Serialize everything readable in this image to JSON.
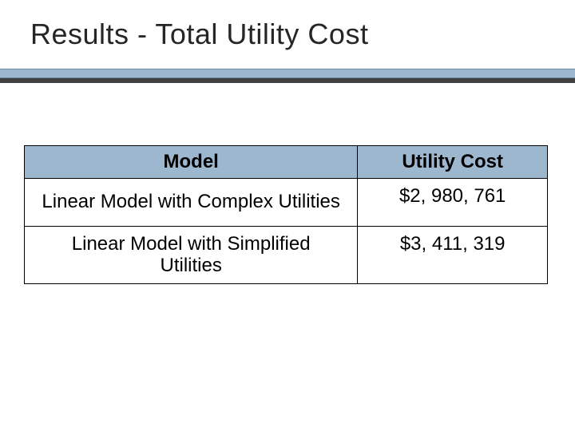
{
  "title": "Results  - Total Utility Cost",
  "table": {
    "headers": {
      "model": "Model",
      "cost": "Utility Cost"
    },
    "rows": [
      {
        "model": "Linear Model with Complex Utilities",
        "cost": "$2, 980, 761"
      },
      {
        "model": "Linear Model with Simplified Utilities",
        "cost": "$3, 411, 319"
      }
    ]
  },
  "colors": {
    "accent": "#9db7cf",
    "divider_dark": "#404040"
  }
}
